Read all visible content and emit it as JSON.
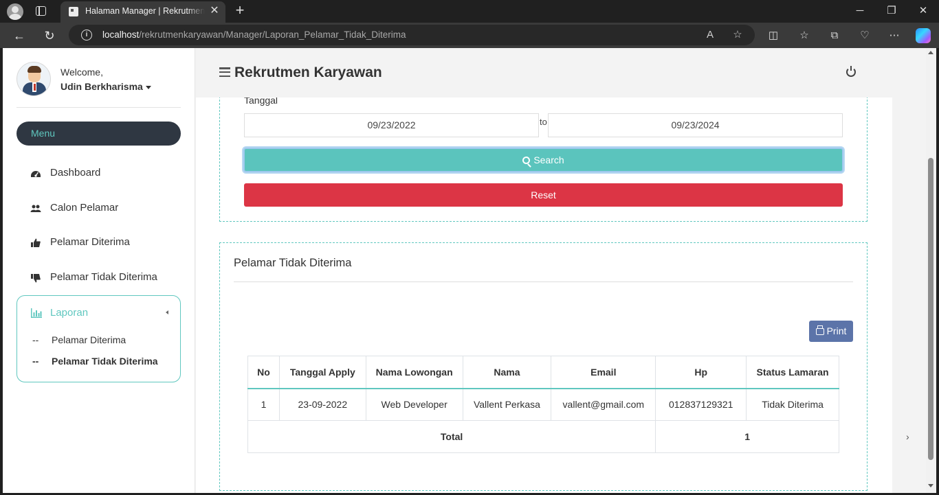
{
  "browser": {
    "tab_title": "Halaman Manager | Rekrutmen Karyawan",
    "url_host": "localhost",
    "url_path": "/rekrutmenkaryawan/Manager/Laporan_Pelamar_Tidak_Diterima"
  },
  "sidebar": {
    "welcome": "Welcome,",
    "username": "Udin Berkharisma",
    "menu_label": "Menu",
    "items": [
      {
        "label": "Dashboard",
        "icon": "dashboard-icon"
      },
      {
        "label": "Calon Pelamar",
        "icon": "users-icon"
      },
      {
        "label": "Pelamar Diterima",
        "icon": "thumbs-up-icon"
      },
      {
        "label": "Pelamar Tidak Diterima",
        "icon": "thumbs-down-icon"
      }
    ],
    "laporan": {
      "label": "Laporan",
      "icon": "bar-chart-icon",
      "dash": "--",
      "subitems": [
        {
          "label": "Pelamar Diterima"
        },
        {
          "label": "Pelamar Tidak Diterima"
        }
      ]
    }
  },
  "header": {
    "title": "Rekrutmen Karyawan"
  },
  "filter": {
    "label": "Tanggal",
    "from": "09/23/2022",
    "to_label": "to",
    "to": "09/23/2024",
    "search_label": "Search",
    "reset_label": "Reset"
  },
  "results": {
    "title": "Pelamar Tidak Diterima",
    "print_label": "Print",
    "columns": [
      "No",
      "Tanggal Apply",
      "Nama Lowongan",
      "Nama",
      "Email",
      "Hp",
      "Status Lamaran"
    ],
    "rows": [
      [
        "1",
        "23-09-2022",
        "Web Developer",
        "Vallent Perkasa",
        "vallent@gmail.com",
        "012837129321",
        "Tidak Diterima"
      ]
    ],
    "total_label": "Total",
    "total_value": "1"
  },
  "colors": {
    "accent": "#5fc7bf",
    "reset": "#dc3545",
    "print": "#5c74a9",
    "menu_bg": "#2f3742"
  }
}
